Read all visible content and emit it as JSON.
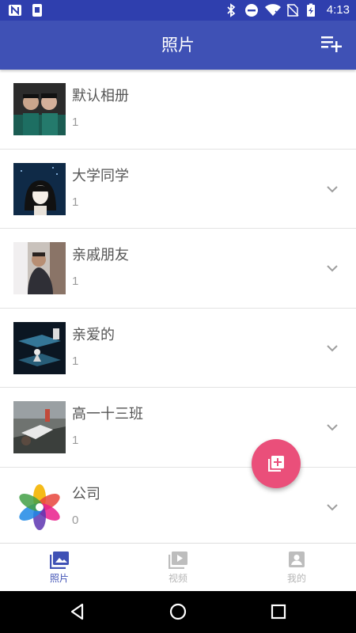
{
  "status_bar": {
    "time": "4:13",
    "left_icons": [
      "nfc-icon",
      "phone-notification-icon"
    ],
    "right_icons": [
      "bluetooth-icon",
      "do-not-disturb-icon",
      "wifi-icon",
      "no-sim-icon",
      "battery-charging-icon"
    ]
  },
  "app_bar": {
    "title": "照片",
    "action_icon": "playlist-add-icon",
    "background": "#3f51b5"
  },
  "albums": [
    {
      "name": "默认相册",
      "count": "1",
      "thumbnail": "two-men-photo",
      "has_chevron": false
    },
    {
      "name": "大学同学",
      "count": "1",
      "thumbnail": "girl-illustration",
      "has_chevron": true
    },
    {
      "name": "亲戚朋友",
      "count": "1",
      "thumbnail": "man-window-photo",
      "has_chevron": true
    },
    {
      "name": "亲爱的",
      "count": "1",
      "thumbnail": "fish-illustration",
      "has_chevron": true
    },
    {
      "name": "高一十三班",
      "count": "1",
      "thumbnail": "street-scene-photo",
      "has_chevron": true
    },
    {
      "name": "公司",
      "count": "0",
      "thumbnail": "pinwheel-logo",
      "has_chevron": true
    }
  ],
  "fab": {
    "icon": "add-to-photos-icon",
    "color": "#ea4f7a"
  },
  "bottom_nav": [
    {
      "label": "照片",
      "icon": "photo-icon",
      "active": true
    },
    {
      "label": "视频",
      "icon": "video-icon",
      "active": false
    },
    {
      "label": "我的",
      "icon": "account-icon",
      "active": false
    }
  ],
  "system_nav": [
    "back-icon",
    "home-icon",
    "recents-icon"
  ]
}
